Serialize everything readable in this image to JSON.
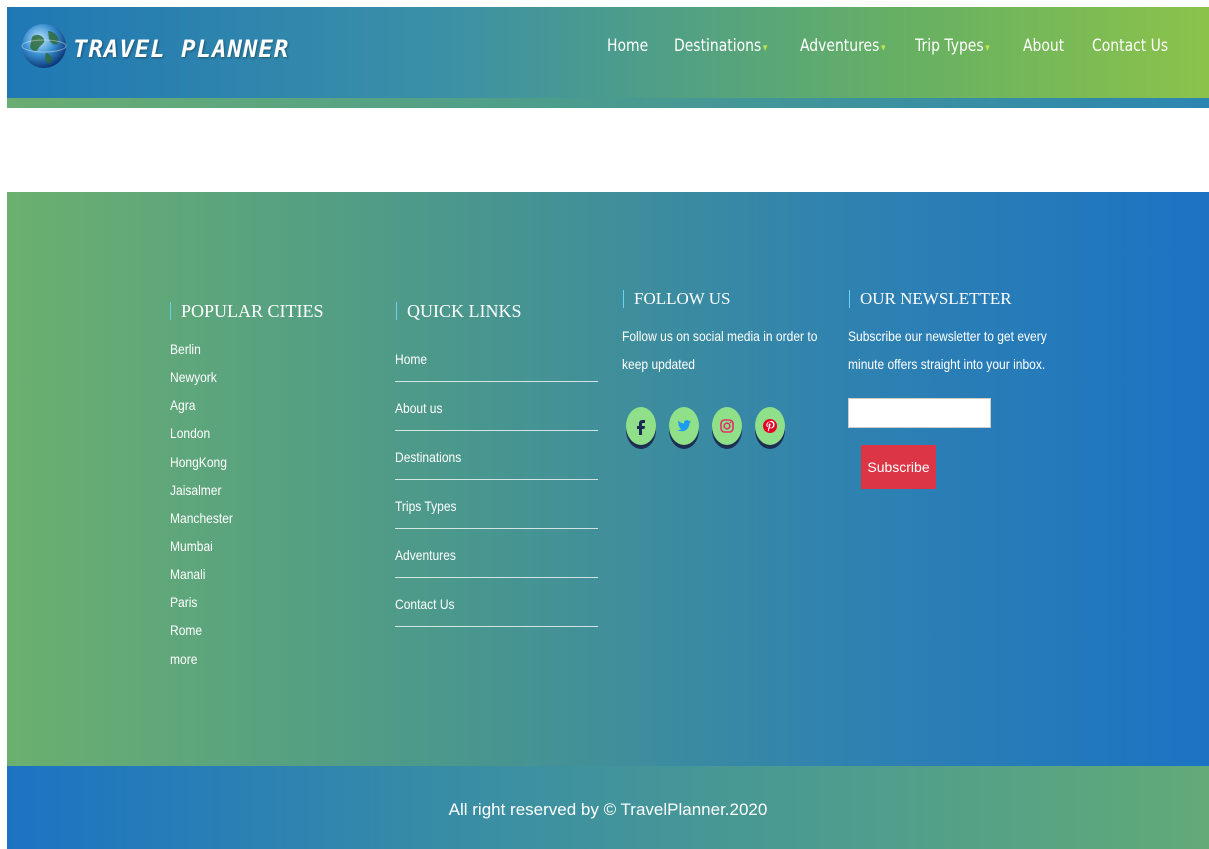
{
  "brand": {
    "name": "TRAVEL PLANNER"
  },
  "nav": {
    "items": [
      {
        "label": "Home"
      },
      {
        "label": "Destinations",
        "caret": "▾"
      },
      {
        "label": "Adventures",
        "caret": "▾"
      },
      {
        "label": "Trip Types",
        "caret": "▾"
      },
      {
        "label": "About"
      },
      {
        "label": "Contact Us"
      }
    ]
  },
  "footer": {
    "popular_cities": {
      "title": "POPULAR CITIES",
      "items": [
        "Berlin",
        "Newyork",
        "Agra",
        "London",
        "HongKong",
        "Jaisalmer",
        "Manchester",
        "Mumbai",
        "Manali",
        "Paris",
        "Rome",
        "more"
      ]
    },
    "quick_links": {
      "title": "QUICK LINKS",
      "items": [
        "Home",
        "About us",
        "Destinations",
        "Trips Types",
        "Adventures",
        "Contact Us"
      ]
    },
    "follow_us": {
      "title": "FOLLOW US",
      "line1": "Follow us on social media in order to",
      "line2": "keep updated",
      "icons": [
        "facebook-icon",
        "twitter-icon",
        "instagram-icon",
        "pinterest-icon"
      ]
    },
    "newsletter": {
      "title": "OUR NEWSLETTER",
      "line1": "Subscribe our newsletter to get every",
      "line2": "minute offers straight into your inbox.",
      "input_value": "",
      "button_label": "Subscribe"
    }
  },
  "copyright": {
    "text": "All right reserved by © TravelPlanner.2020"
  },
  "colors": {
    "accent_green": "#8bc34a",
    "subscribe_red": "#dc3545",
    "social_bg": "#8fe089"
  }
}
